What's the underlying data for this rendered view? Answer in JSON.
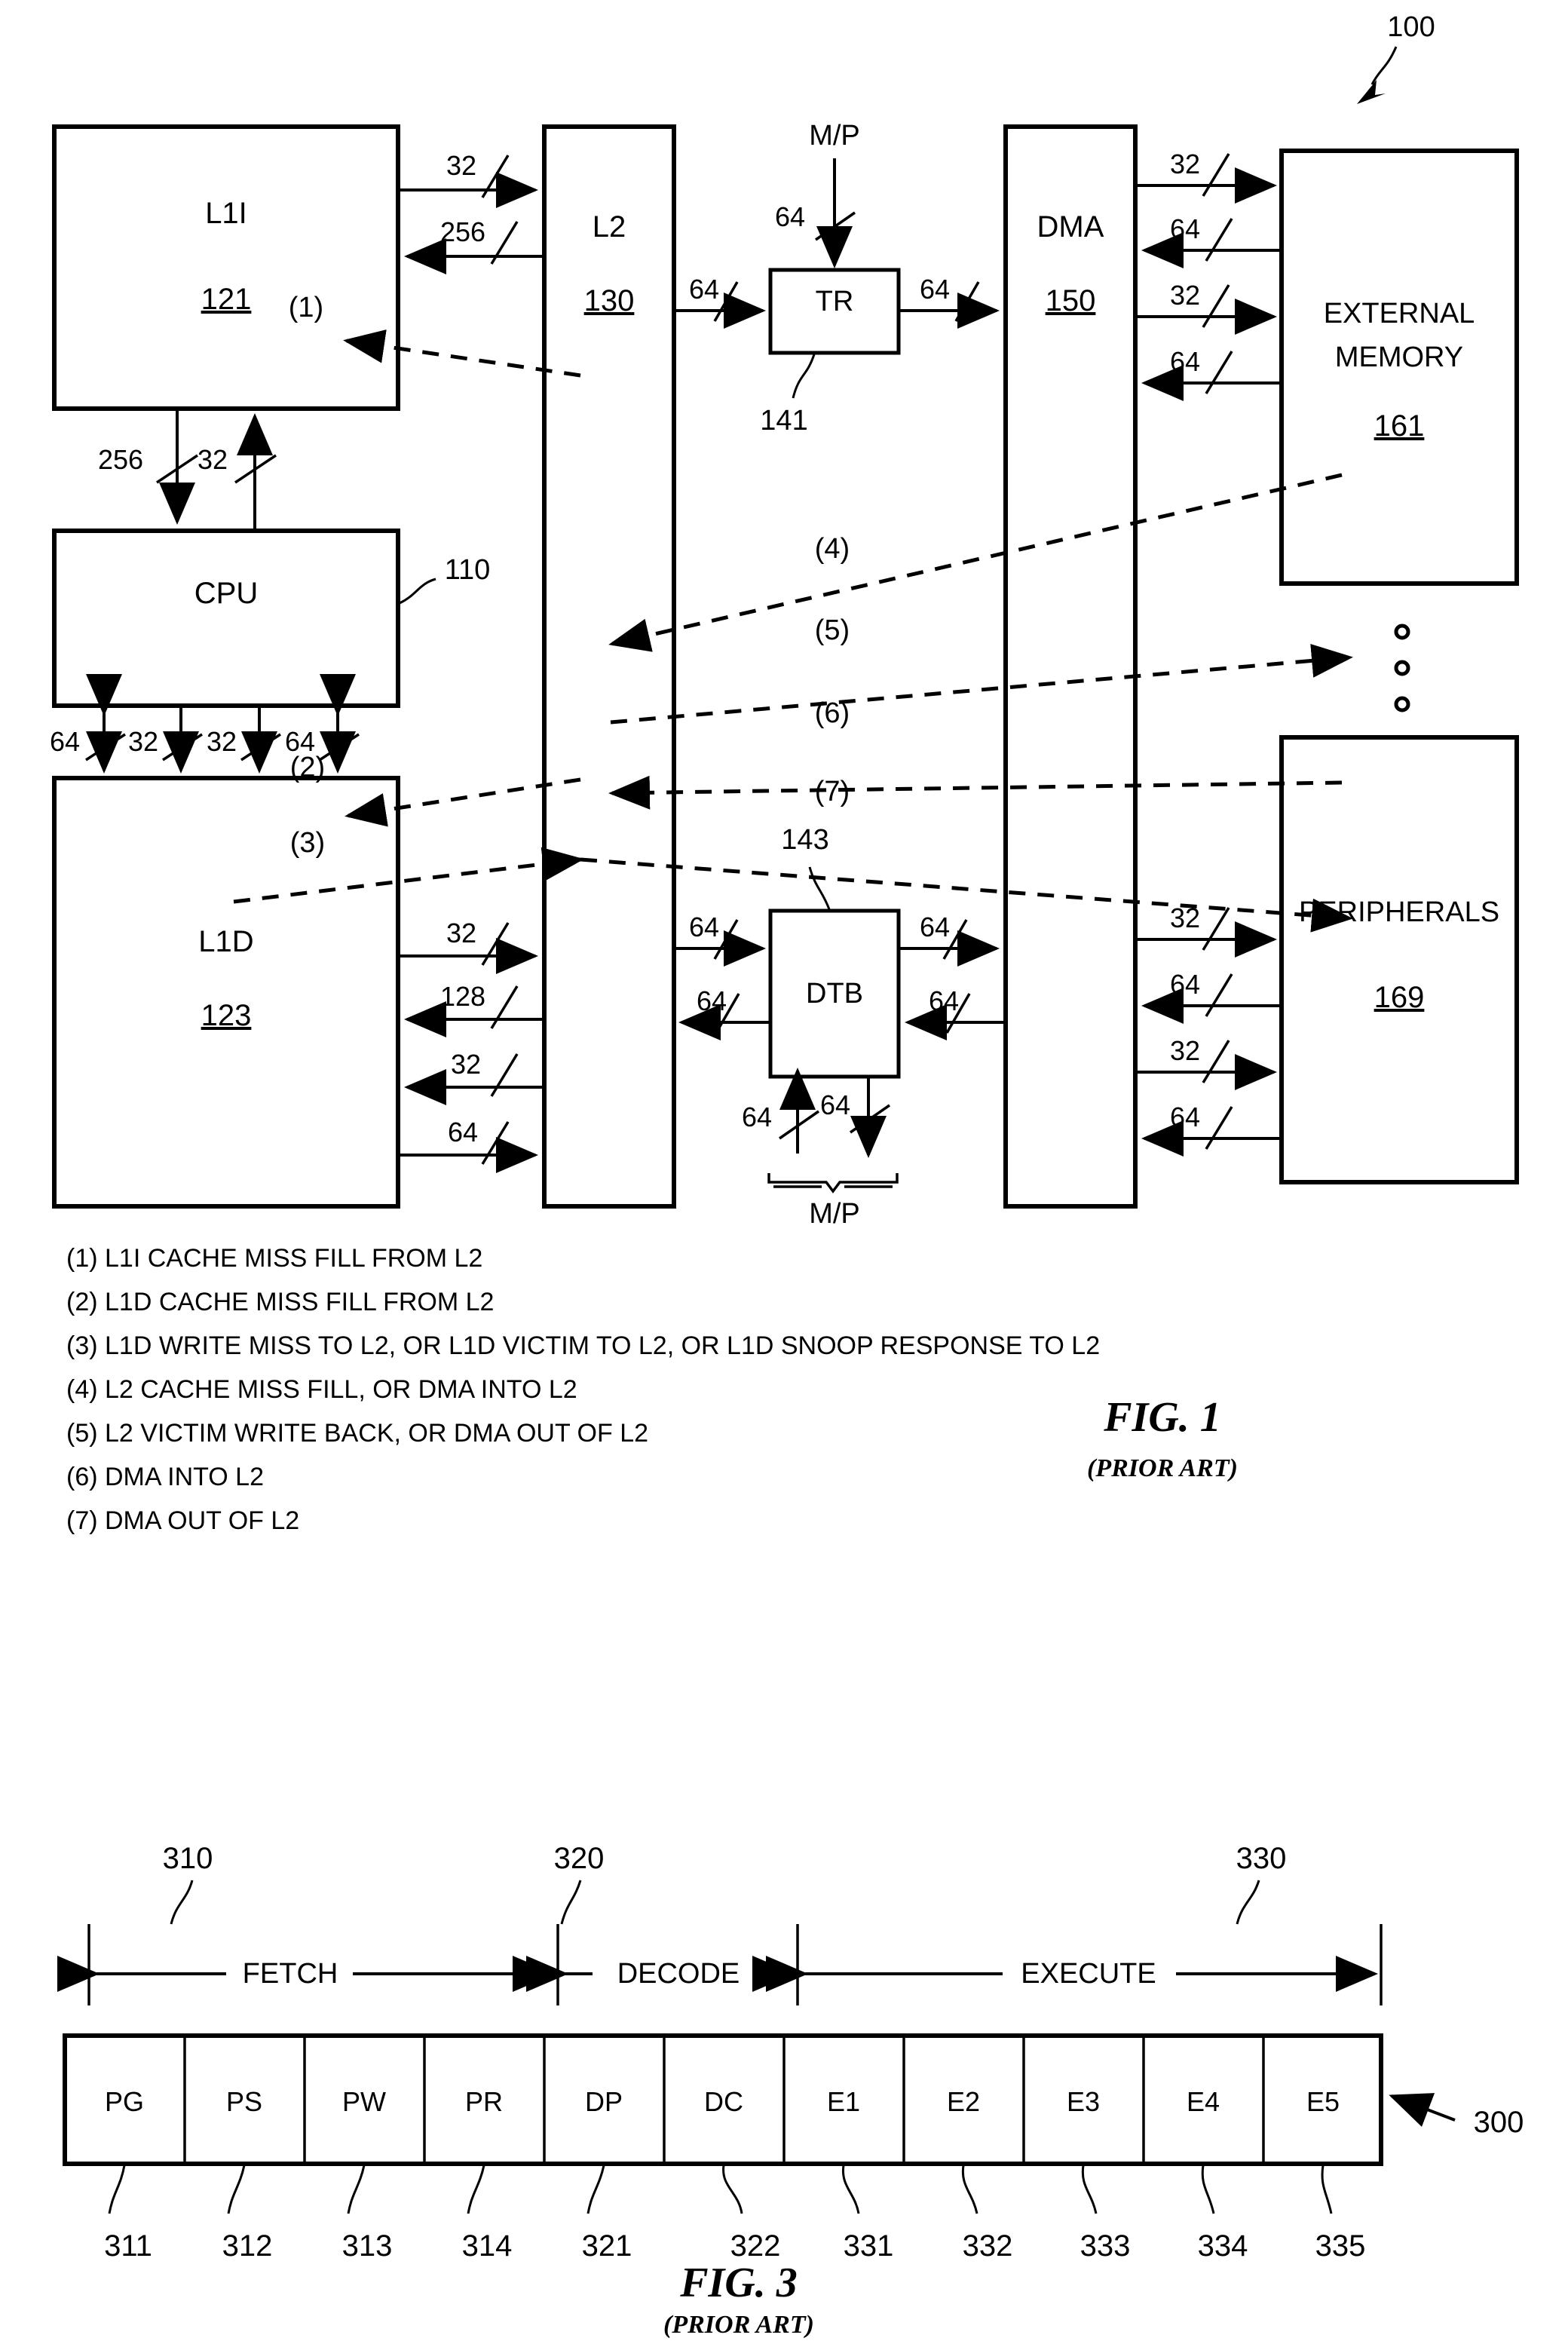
{
  "figure1": {
    "ref_100": "100",
    "blocks": {
      "l1i": {
        "label": "L1I",
        "ref": "121"
      },
      "l2": {
        "label": "L2",
        "ref": "130"
      },
      "cpu": {
        "label": "CPU",
        "ref": "110"
      },
      "l1d": {
        "label": "L1D",
        "ref": "123"
      },
      "tr": {
        "label": "TR",
        "ref": "141"
      },
      "dtb": {
        "label": "DTB",
        "ref": "143"
      },
      "dma": {
        "label": "DMA",
        "ref": "150"
      },
      "extmem": {
        "label_line1": "EXTERNAL",
        "label_line2": "MEMORY",
        "ref": "161"
      },
      "peripherals": {
        "label": "PERIPHERALS",
        "ref": "169"
      }
    },
    "mp_top": "M/P",
    "mp_bottom": "M/P",
    "bus_widths": {
      "l1i_to_l2": "32",
      "l2_to_l1i": "256",
      "l1i_to_cpu": "256",
      "cpu_to_l1i": "32",
      "cpu_l1d_1": "64",
      "cpu_l1d_2": "32",
      "cpu_l1d_3": "32",
      "cpu_l1d_4": "64",
      "l1d_to_l2_a": "32",
      "l2_to_l1d_a": "128",
      "l2_to_l1d_b": "32",
      "l1d_to_l2_b": "64",
      "l2_to_tr": "64",
      "tr_to_dma": "64",
      "mp_to_tr": "64",
      "l2_to_dtb": "64",
      "dtb_to_l2": "64",
      "dtb_to_dma": "64",
      "dma_to_dtb": "64",
      "mp_to_dtb": "64",
      "dtb_to_mp": "64",
      "dma_ext_1": "32",
      "dma_ext_2": "64",
      "dma_ext_3": "32",
      "dma_ext_4": "64",
      "dma_per_1": "32",
      "dma_per_2": "64",
      "dma_per_3": "32",
      "dma_per_4": "64"
    },
    "flow_tags": [
      "(1)",
      "(2)",
      "(3)",
      "(4)",
      "(5)",
      "(6)",
      "(7)"
    ],
    "legend": [
      "(1) L1I CACHE MISS FILL FROM L2",
      "(2) L1D CACHE MISS FILL FROM L2",
      "(3) L1D WRITE MISS TO L2, OR L1D VICTIM TO L2, OR L1D SNOOP RESPONSE TO L2",
      "(4) L2 CACHE MISS FILL, OR DMA INTO L2",
      "(5) L2 VICTIM WRITE BACK, OR DMA OUT OF L2",
      "(6) DMA INTO L2",
      "(7) DMA OUT OF L2"
    ],
    "caption_title": "FIG. 1",
    "caption_sub": "(PRIOR ART)"
  },
  "figure3": {
    "ref_300": "300",
    "group_refs": {
      "fetch": "310",
      "decode": "320",
      "execute": "330"
    },
    "groups": [
      {
        "label": "FETCH",
        "ref": "310"
      },
      {
        "label": "DECODE",
        "ref": "320"
      },
      {
        "label": "EXECUTE",
        "ref": "330"
      }
    ],
    "stages": [
      {
        "label": "PG",
        "ref": "311"
      },
      {
        "label": "PS",
        "ref": "312"
      },
      {
        "label": "PW",
        "ref": "313"
      },
      {
        "label": "PR",
        "ref": "314"
      },
      {
        "label": "DP",
        "ref": "321"
      },
      {
        "label": "DC",
        "ref": "322"
      },
      {
        "label": "E1",
        "ref": "331"
      },
      {
        "label": "E2",
        "ref": "332"
      },
      {
        "label": "E3",
        "ref": "333"
      },
      {
        "label": "E4",
        "ref": "334"
      },
      {
        "label": "E5",
        "ref": "335"
      }
    ],
    "caption_title": "FIG. 3",
    "caption_sub": "(PRIOR ART)"
  }
}
